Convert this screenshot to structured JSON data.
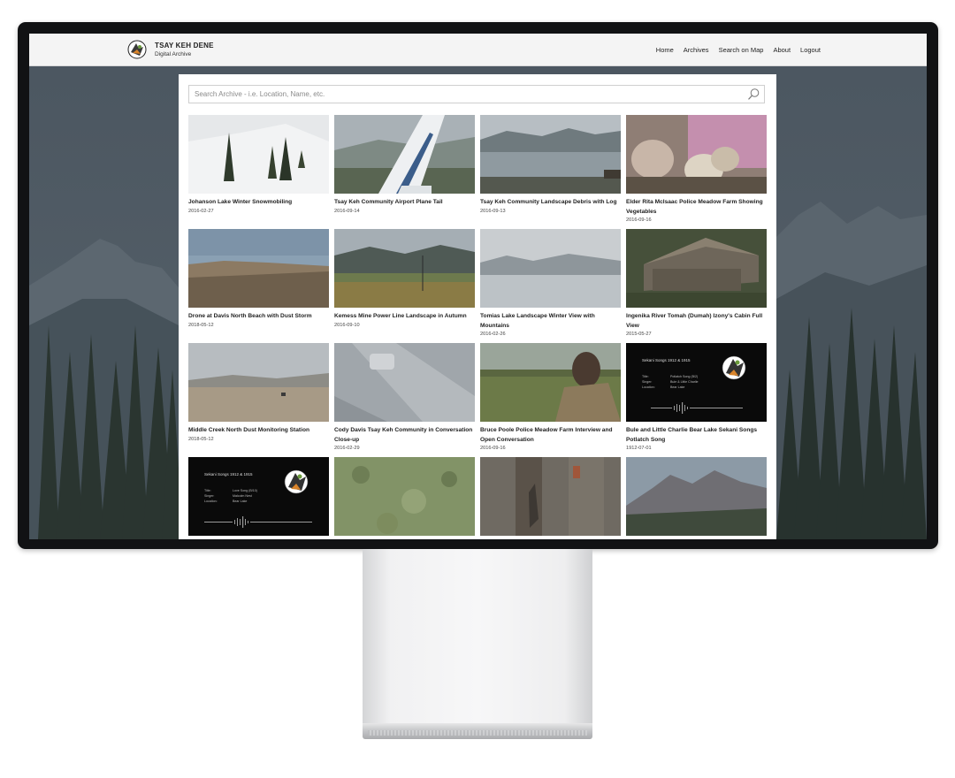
{
  "header": {
    "title": "TSAY KEH DENE",
    "subtitle": "Digital Archive",
    "nav": [
      "Home",
      "Archives",
      "Search on Map",
      "About",
      "Logout"
    ]
  },
  "search": {
    "placeholder": "Search Archive - i.e. Location, Name, etc.",
    "icon": "search-icon"
  },
  "items": [
    {
      "title": "Johanson Lake Winter Snowmobiling",
      "date": "2016-02-27"
    },
    {
      "title": "Tsay Keh Community Airport Plane Tail",
      "date": "2016-09-14"
    },
    {
      "title": "Tsay Keh Community Landscape Debris with Log",
      "date": "2016-09-13"
    },
    {
      "title": "Elder Rita McIsaac Police Meadow Farm Showing Vegetables",
      "date": "2016-09-16"
    },
    {
      "title": "Drone at Davis North Beach with Dust Storm",
      "date": "2018-05-12"
    },
    {
      "title": "Kemess Mine Power Line Landscape in Autumn",
      "date": "2016-09-10"
    },
    {
      "title": "Tomias Lake Landscape Winter View with Mountains",
      "date": "2016-02-26"
    },
    {
      "title": "Ingenika River Tomah (Dumah) Izony's Cabin Full View",
      "date": "2015-05-27"
    },
    {
      "title": "Middle Creek North Dust Monitoring Station",
      "date": "2018-05-12"
    },
    {
      "title": "Cody Davis Tsay Keh Community in Conversation Close-up",
      "date": "2016-02-29"
    },
    {
      "title": "Bruce Poole Police Meadow Farm Interview and Open Conversation",
      "date": "2016-09-16"
    },
    {
      "title": "Bule and Little Charlie Bear Lake Sekani Songs Potlatch Song",
      "date": "1912-07-01"
    },
    {
      "title": "",
      "date": ""
    },
    {
      "title": "",
      "date": ""
    },
    {
      "title": "",
      "date": ""
    },
    {
      "title": "",
      "date": ""
    }
  ],
  "song_cards": [
    {
      "heading": "Sekani Songs 1912 & 1915",
      "fields": [
        {
          "label": "Title:",
          "value": "Potlatch Song (B/2)"
        },
        {
          "label": "Singer:",
          "value": "Bule & Little Charlie"
        },
        {
          "label": "Location:",
          "value": "Bear Lake"
        }
      ]
    },
    {
      "heading": "Sekani Songs 1912 & 1915",
      "fields": [
        {
          "label": "Title:",
          "value": "Love Song (B/10)"
        },
        {
          "label": "Singer:",
          "value": "Malcolm Nest"
        },
        {
          "label": "Location:",
          "value": "Bear Lake"
        }
      ]
    }
  ],
  "colors": {
    "header_bg": "#f4f4f4",
    "panel_bg": "#ffffff",
    "screen_overlay": "#3f4850"
  }
}
